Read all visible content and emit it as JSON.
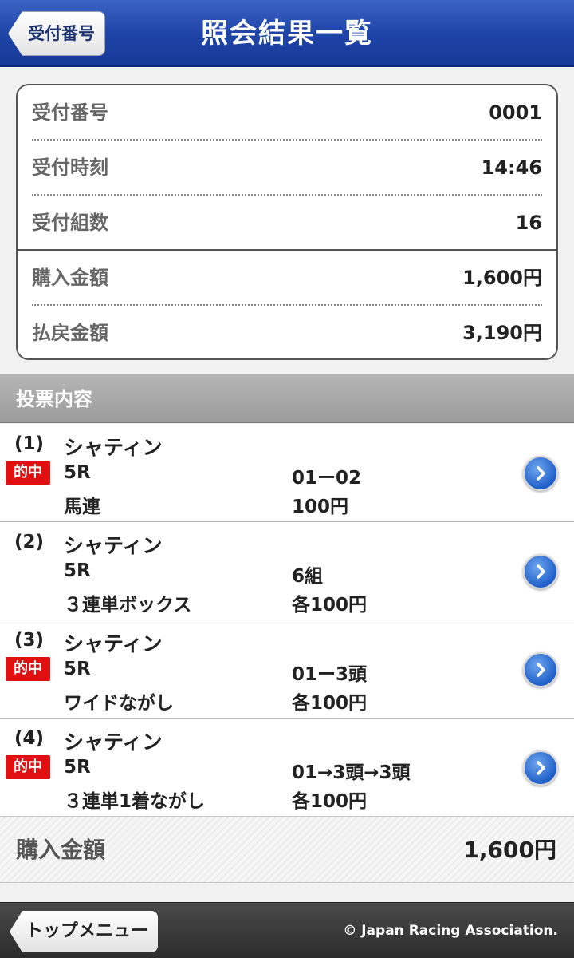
{
  "header": {
    "back_label": "受付番号",
    "title": "照会結果一覧"
  },
  "summary": {
    "receipt_number": {
      "label": "受付番号",
      "value": "0001"
    },
    "receipt_time": {
      "label": "受付時刻",
      "value": "14:46"
    },
    "combination_count": {
      "label": "受付組数",
      "value": "16"
    },
    "purchase_amount": {
      "label": "購入金額",
      "value": "1,600円"
    },
    "payout_amount": {
      "label": "払戻金額",
      "value": "3,190円"
    }
  },
  "section_title": "投票内容",
  "hit_label": "的中",
  "bets": [
    {
      "number": "(1)",
      "venue": "シャティン",
      "race": "5R",
      "type": "馬連",
      "combination": "01ー02",
      "amount": "100円",
      "hit": true
    },
    {
      "number": "(2)",
      "venue": "シャティン",
      "race": "5R",
      "type": "３連単ボックス",
      "combination": "6組",
      "amount": "各100円",
      "hit": false
    },
    {
      "number": "(3)",
      "venue": "シャティン",
      "race": "5R",
      "type": "ワイドながし",
      "combination": "01ー3頭",
      "amount": "各100円",
      "hit": true
    },
    {
      "number": "(4)",
      "venue": "シャティン",
      "race": "5R",
      "type": "３連単1着ながし",
      "combination": "01→3頭→3頭",
      "amount": "各100円",
      "hit": true
    }
  ],
  "total": {
    "label": "購入金額",
    "value": "1,600円"
  },
  "footer": {
    "top_menu_label": "トップメニュー",
    "copyright": "© Japan Racing Association."
  },
  "colors": {
    "header_blue": "#1f45a8",
    "hit_red": "#e01010",
    "detail_button_blue": "#1f5fc9"
  }
}
